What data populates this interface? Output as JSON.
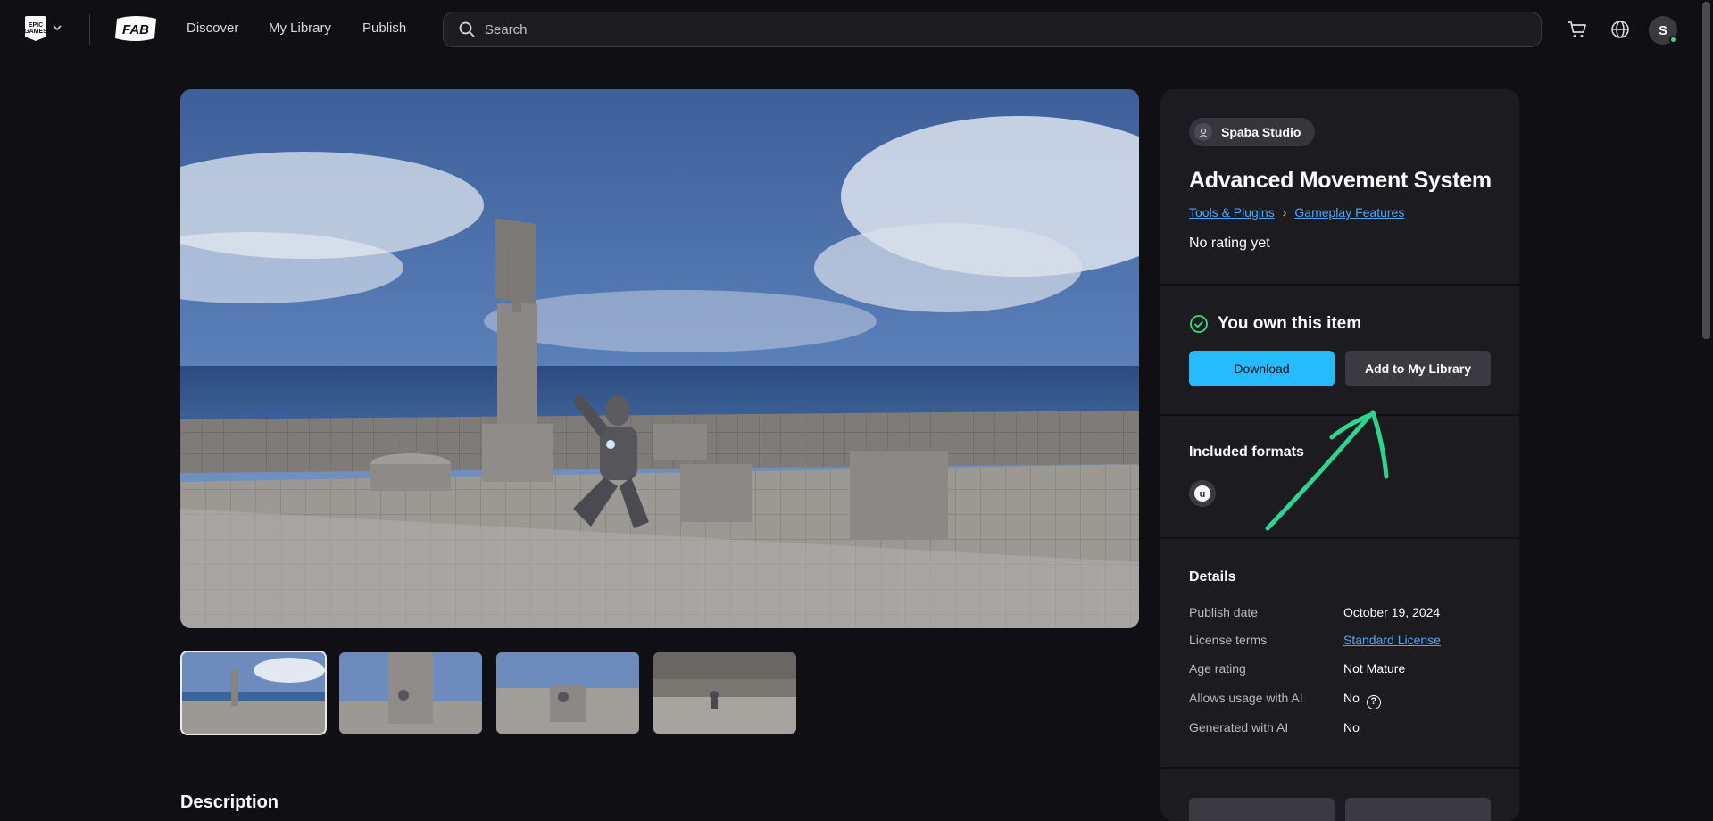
{
  "nav": {
    "epic_logo_text": "EPIC GAMES",
    "fab_logo_text": "FAB",
    "links": [
      "Discover",
      "My Library",
      "Publish"
    ],
    "search_placeholder": "Search",
    "avatar_initial": "S",
    "icons": [
      "cart-icon",
      "globe-icon"
    ]
  },
  "gallery": {
    "thumbnail_count": 4,
    "active_index": 0
  },
  "description": {
    "heading": "Description"
  },
  "product": {
    "seller": "Spaba Studio",
    "title": "Advanced Movement System",
    "breadcrumb": [
      "Tools & Plugins",
      "Gameplay Features"
    ],
    "rating": "No rating yet",
    "owned_text": "You own this item",
    "download_label": "Download",
    "add_library_label": "Add to My Library",
    "formats_heading": "Included formats",
    "formats": [
      "unreal-engine-icon"
    ],
    "details_heading": "Details",
    "details": [
      {
        "label": "Publish date",
        "value": "October 19, 2024"
      },
      {
        "label": "License terms",
        "value": "Standard License"
      },
      {
        "label": "Age rating",
        "value": "Not Mature"
      },
      {
        "label": "Allows usage with AI",
        "value": "No"
      },
      {
        "label": "Generated with AI",
        "value": "No"
      }
    ]
  },
  "colors": {
    "background": "#101014",
    "panel": "#1b1b20",
    "accent": "#26bbff",
    "link": "#4aa8ff",
    "owned_check": "#3ddc84",
    "annotation_arrow": "#2fd58f"
  }
}
